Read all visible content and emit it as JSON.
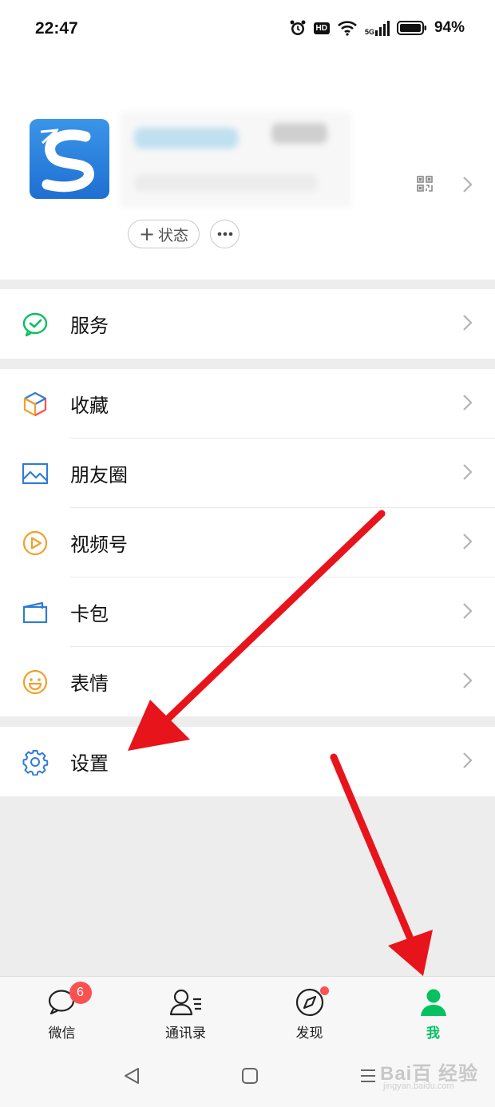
{
  "status_bar": {
    "time": "22:47",
    "hd_label": "HD",
    "network_label": "5G",
    "battery": "94%"
  },
  "profile": {
    "status_button_label": "状态",
    "qr_icon": "qr-code-icon",
    "more_icon": "more-dots-icon"
  },
  "menu": {
    "services": {
      "label": "服务",
      "icon": "services-icon"
    },
    "favorites": {
      "label": "收藏",
      "icon": "cube-icon"
    },
    "moments": {
      "label": "朋友圈",
      "icon": "picture-icon"
    },
    "channels": {
      "label": "视频号",
      "icon": "play-circle-icon"
    },
    "cards": {
      "label": "卡包",
      "icon": "wallet-icon"
    },
    "stickers": {
      "label": "表情",
      "icon": "smile-icon"
    },
    "settings": {
      "label": "设置",
      "icon": "gear-icon"
    }
  },
  "tabbar": {
    "chats": {
      "label": "微信",
      "badge": "6"
    },
    "contacts": {
      "label": "通讯录"
    },
    "discover": {
      "label": "发现"
    },
    "me": {
      "label": "我"
    },
    "active": "me"
  },
  "watermark": {
    "text": "Bai百 经验",
    "sub": "jingyan.baidu.com"
  },
  "colors": {
    "wechat_green": "#07c160",
    "badge_red": "#fa5151",
    "icon_blue": "#2f7bd7",
    "icon_orange": "#f0a02b",
    "arrow_red": "#e8141b"
  }
}
